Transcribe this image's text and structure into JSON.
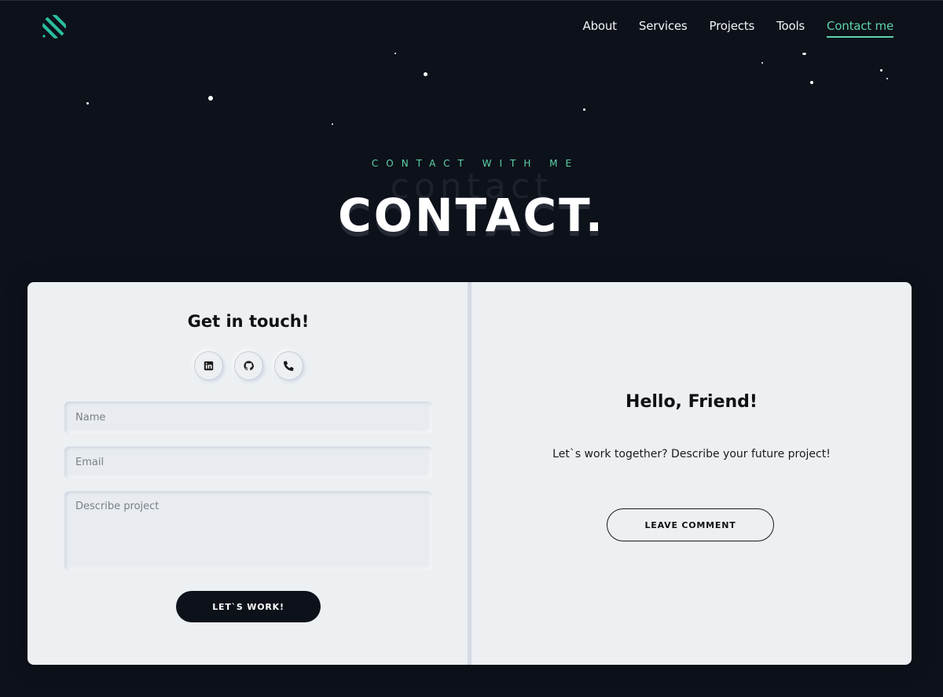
{
  "header": {
    "logo_icon": "striped-circle-logo",
    "nav": [
      {
        "label": "About"
      },
      {
        "label": "Services"
      },
      {
        "label": "Projects"
      },
      {
        "label": "Tools"
      },
      {
        "label": "Contact me",
        "active": true
      }
    ]
  },
  "section": {
    "eyebrow": "CONTACT WITH ME",
    "ghost_text": "contact",
    "title": "CONTACT."
  },
  "contact_form": {
    "heading": "Get in touch!",
    "socials": [
      {
        "icon": "linkedin-icon"
      },
      {
        "icon": "github-icon"
      },
      {
        "icon": "phone-icon"
      }
    ],
    "name_placeholder": "Name",
    "email_placeholder": "Email",
    "project_placeholder": "Describe project",
    "submit_label": "LET`S WORK!"
  },
  "hello_panel": {
    "heading": "Hello, Friend!",
    "text": "Let`s work together? Describe your future project!",
    "button_label": "LEAVE COMMENT"
  },
  "colors": {
    "background": "#0d111a",
    "accent": "#5fd3a8",
    "card": "#ecf0f3"
  }
}
